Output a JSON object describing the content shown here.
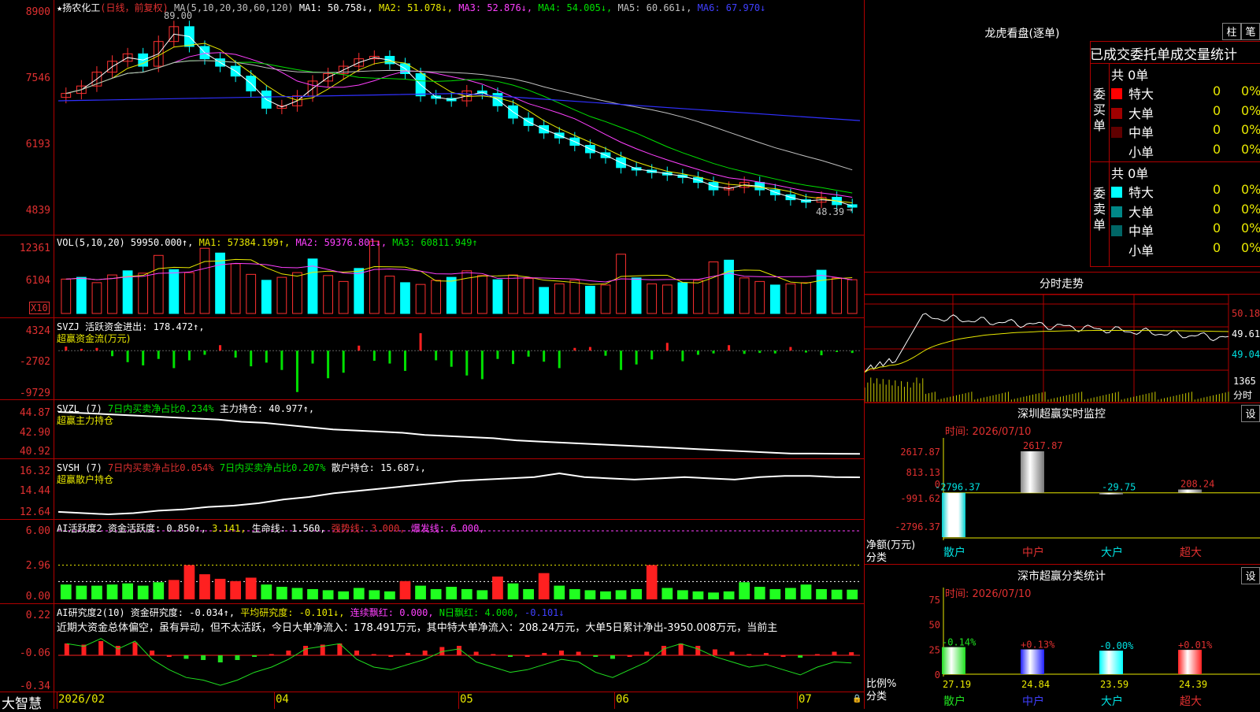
{
  "stock": {
    "name": "扬农化工",
    "period_label": "(日线，前复权)",
    "high_marker": "89.00",
    "low_marker": "48.39"
  },
  "main_panel": {
    "legend": [
      {
        "text": "MA(5,10,20,30,60,120)",
        "color": "#c0c0c0"
      },
      {
        "text": "MA1: 50.758↓,",
        "color": "#ffffff"
      },
      {
        "text": "MA2: 51.078↓,",
        "color": "#e8e800"
      },
      {
        "text": "MA3: 52.876↓,",
        "color": "#ff40ff"
      },
      {
        "text": "MA4: 54.005↓,",
        "color": "#00e000"
      },
      {
        "text": "MA5: 60.661↓,",
        "color": "#c0c0c0"
      },
      {
        "text": "MA6: 67.970↓",
        "color": "#4040ff"
      }
    ],
    "y_ticks": [
      "8900",
      "7546",
      "6193",
      "4839"
    ]
  },
  "vol_panel": {
    "legend": [
      {
        "text": "VOL(5,10,20) 59950.000↑,",
        "color": "#ffffff"
      },
      {
        "text": "MA1: 57384.199↑,",
        "color": "#e8e800"
      },
      {
        "text": "MA2: 59376.801↓,",
        "color": "#ff40ff"
      },
      {
        "text": "MA3: 60811.949↑",
        "color": "#00e000"
      }
    ],
    "y_ticks": [
      "12361",
      "6104"
    ],
    "unit": "X10"
  },
  "svzj_panel": {
    "legend": [
      {
        "text": "SVZJ  活跃资金进出: 178.472↑,",
        "color": "#ffffff"
      }
    ],
    "subtitle": "超赢资金流(万元)",
    "y_ticks": [
      "4324",
      "-2702",
      "-9729"
    ]
  },
  "svzl_panel": {
    "legend": [
      {
        "text": "SVZL (7)",
        "color": "#ffffff"
      },
      {
        "text": "7日内买卖净占比0.234%",
        "color": "#00e000"
      },
      {
        "text": "主力持仓: 40.977↑,",
        "color": "#ffffff"
      }
    ],
    "subtitle": "超赢主力持仓",
    "y_ticks": [
      "44.87",
      "42.90",
      "40.92"
    ]
  },
  "svsh_panel": {
    "legend": [
      {
        "text": "SVSH (7)",
        "color": "#ffffff"
      },
      {
        "text": "7日内买卖净占比0.054%",
        "color": "#e03030"
      },
      {
        "text": "7日内买卖净占比0.207%",
        "color": "#00e000"
      },
      {
        "text": "散户持仓: 15.687↓,",
        "color": "#ffffff"
      }
    ],
    "subtitle": "超赢散户持仓",
    "y_ticks": [
      "16.32",
      "14.44",
      "12.64"
    ]
  },
  "ai_active_panel": {
    "legend": [
      {
        "text": "AI活跃度2 资金活跃度: 0.850↑,",
        "color": "#ffffff"
      },
      {
        "text": "3.141,",
        "color": "#e8e800"
      },
      {
        "text": "生命线: 1.560,",
        "color": "#ffffff"
      },
      {
        "text": "强势线: 3.000,",
        "color": "#e03030"
      },
      {
        "text": "爆发线: 6.000,",
        "color": "#ff40ff"
      }
    ],
    "y_ticks": [
      "6.00",
      "2.96",
      "0.00"
    ]
  },
  "ai_research_panel": {
    "legend": [
      {
        "text": "AI研究度2(10) 资金研究度: -0.034↑,",
        "color": "#ffffff"
      },
      {
        "text": "平均研究度: -0.101↓,",
        "color": "#e8e800"
      },
      {
        "text": "连续飘红: 0.000,",
        "color": "#ff40ff"
      },
      {
        "text": "N日飘红: 4.000,",
        "color": "#00e000"
      },
      {
        "text": "-0.101↓",
        "color": "#4040ff"
      }
    ],
    "commentary": "近期大资金总体偏空，虽有异动，但不太活跃，今日大单净流入：178.491万元，其中特大单净流入：208.24万元，大单5日累计净出-3950.008万元，当前主",
    "y_ticks": [
      "0.22",
      "-0.06",
      "-0.34"
    ]
  },
  "x_axis": [
    "2026/02",
    "04",
    "05",
    "06",
    "07"
  ],
  "brand": "大智慧",
  "dragon_tiger": {
    "title": "龙虎看盘(逐单)",
    "btn_bar": "柱",
    "btn_stroke": "笔",
    "subtitle": "已成交委托单成交量统计",
    "buy_label": "委买单",
    "sell_label": "委卖单",
    "buy_total": "共 0单",
    "sell_total": "共 0单",
    "buy_rows": [
      {
        "label": "特大",
        "count": "0",
        "pct": "0%",
        "color": "#ff0000"
      },
      {
        "label": "大单",
        "count": "0",
        "pct": "0%",
        "color": "#a00000"
      },
      {
        "label": "中单",
        "count": "0",
        "pct": "0%",
        "color": "#600000"
      },
      {
        "label": "小单",
        "count": "0",
        "pct": "0%",
        "color": ""
      }
    ],
    "sell_rows": [
      {
        "label": "特大",
        "count": "0",
        "pct": "0%",
        "color": "#00ffff"
      },
      {
        "label": "大单",
        "count": "0",
        "pct": "0%",
        "color": "#008888"
      },
      {
        "label": "中单",
        "count": "0",
        "pct": "0%",
        "color": "#006666"
      },
      {
        "label": "小单",
        "count": "0",
        "pct": "0%",
        "color": ""
      }
    ]
  },
  "intraday": {
    "title": "分时走势",
    "y_ticks": [
      "50.18",
      "49.61",
      "49.04"
    ],
    "vol_tick": "1365",
    "vol_label": "分时"
  },
  "sz_monitor": {
    "title": "深圳超赢实时监控",
    "btn": "设",
    "time": "时间: 2026/07/10",
    "y_ticks": [
      "2617.87",
      "813.13",
      "0",
      "-991.62",
      "-2796.37"
    ],
    "y_label": "净额(万元)",
    "x_label": "分类",
    "categories": [
      "散户",
      "中户",
      "大户",
      "超大"
    ],
    "values": [
      "-2796.37",
      "2617.87",
      "-29.75",
      "208.24"
    ]
  },
  "sz_class": {
    "title": "深市超赢分类统计",
    "btn": "设",
    "time": "时间: 2026/07/10",
    "y_ticks": [
      "75",
      "50",
      "25",
      "0"
    ],
    "y_label": "比例%",
    "x_label": "分类",
    "categories": [
      "散户",
      "中户",
      "大户",
      "超大"
    ],
    "changes": [
      "-0.14%",
      "+0.13%",
      "-0.00%",
      "+0.01%"
    ],
    "values": [
      "27.19",
      "24.84",
      "23.59",
      "24.39"
    ]
  },
  "chart_data": [
    {
      "type": "candlestick",
      "title": "扬农化工(日线，前复权)",
      "ylim": [
        4839,
        8900
      ],
      "x": [
        "2026/02",
        "04",
        "05",
        "06",
        "07"
      ],
      "close": [
        7250,
        7400,
        7680,
        7900,
        8050,
        7800,
        8300,
        8600,
        8200,
        7950,
        7800,
        7600,
        7300,
        6950,
        7000,
        7200,
        7500,
        7650,
        7800,
        7950,
        8000,
        7850,
        7650,
        7200,
        7150,
        7100,
        7300,
        7250,
        7000,
        6750,
        6600,
        6450,
        6350,
        6200,
        6050,
        5950,
        5750,
        5700,
        5650,
        5600,
        5550,
        5450,
        5300,
        5350,
        5450,
        5300,
        5200,
        5100,
        5050,
        5150,
        5000,
        4950
      ]
    },
    {
      "type": "bar",
      "title": "VOL(5,10,20)",
      "ylim": [
        0,
        12361
      ],
      "values": [
        5800,
        6100,
        5200,
        6500,
        7200,
        6800,
        9800,
        7400,
        6900,
        11000,
        10200,
        8400,
        6600,
        5600,
        6100,
        6900,
        9200,
        6400,
        5400,
        7600,
        12200,
        6300,
        5200,
        4900,
        5600,
        6100,
        7200,
        6400,
        5700,
        6500,
        5900,
        4400,
        5000,
        5600,
        4600,
        4800,
        10000,
        6000,
        5000,
        4800,
        5200,
        5600,
        8700,
        9000,
        6000,
        5400,
        4800,
        5000,
        5200,
        7300,
        6000,
        5700
      ]
    },
    {
      "type": "bar",
      "title": "超赢资金流(万元)",
      "ylim": [
        -9729,
        4324
      ],
      "values": [
        900,
        400,
        600,
        -1200,
        -2500,
        -3200,
        -1800,
        -3800,
        -2100,
        -900,
        1200,
        -1500,
        -3400,
        -2600,
        -4200,
        -9000,
        -2800,
        -6000,
        -4800,
        1100,
        -2200,
        -2800,
        -4400,
        3800,
        -2100,
        -3500,
        -5400,
        -6200,
        -1800,
        -2900,
        -1300,
        -2400,
        -3800,
        600,
        800,
        -1100,
        -4200,
        -3000,
        -1900,
        1700,
        -2300,
        -900,
        -600,
        1200,
        -700,
        -500,
        -600,
        800,
        -400,
        -1000,
        -300,
        -500
      ]
    },
    {
      "type": "line",
      "title": "超赢主力持仓",
      "ylim": [
        40.92,
        44.87
      ],
      "values": [
        44.8,
        44.7,
        44.6,
        44.5,
        44.4,
        44.3,
        44.2,
        44.1,
        43.9,
        43.8,
        43.6,
        43.4,
        43.2,
        43.1,
        43.0,
        42.9,
        42.7,
        42.6,
        42.5,
        42.4,
        42.2,
        42.1,
        42.0,
        41.9,
        41.8,
        41.7,
        41.6,
        41.5,
        41.4,
        41.3,
        41.2,
        41.1,
        41.0,
        41.0,
        40.98,
        40.977
      ]
    },
    {
      "type": "line",
      "title": "超赢散户持仓",
      "ylim": [
        12.64,
        16.32
      ],
      "values": [
        12.9,
        12.8,
        12.7,
        12.8,
        13.0,
        13.1,
        13.3,
        13.4,
        13.6,
        13.9,
        14.1,
        14.4,
        14.6,
        14.8,
        15.0,
        15.2,
        15.4,
        15.5,
        15.6,
        15.7,
        16.0,
        15.7,
        15.6,
        15.5,
        15.6,
        15.7,
        15.6,
        15.5,
        15.7,
        15.8,
        15.8,
        15.7,
        15.687
      ]
    },
    {
      "type": "bar",
      "title": "AI活跃度2",
      "ylim": [
        0,
        6.0
      ],
      "values": [
        1.3,
        1.2,
        1.2,
        1.3,
        1.4,
        1.2,
        1.5,
        1.7,
        3.0,
        2.2,
        1.8,
        1.6,
        1.9,
        1.3,
        1.1,
        1.0,
        0.9,
        0.8,
        0.7,
        1.0,
        0.8,
        0.7,
        1.6,
        1.2,
        0.9,
        1.1,
        0.9,
        0.8,
        2.0,
        1.4,
        0.9,
        2.3,
        1.2,
        0.9,
        0.8,
        0.7,
        0.8,
        0.9,
        3.0,
        1.0,
        0.8,
        0.7,
        0.6,
        0.7,
        1.5,
        1.1,
        0.9,
        1.0,
        1.3,
        0.9,
        0.85,
        0.85
      ]
    },
    {
      "type": "bar",
      "title": "AI研究度2(10)",
      "ylim": [
        -0.34,
        0.22
      ],
      "values": [
        0.04,
        0.03,
        0.06,
        0.02,
        0.05,
        -0.02,
        -0.06,
        -0.09,
        -0.1,
        -0.12,
        -0.1,
        -0.07,
        -0.05,
        -0.02,
        0.02,
        0.03,
        0.04,
        -0.02,
        -0.05,
        -0.06,
        -0.04,
        -0.02,
        0.01,
        0.02,
        -0.03,
        -0.05,
        -0.07,
        -0.06,
        -0.04,
        -0.02,
        -0.03,
        -0.07,
        -0.09,
        -0.06,
        -0.03,
        0.02,
        0.04,
        0.02,
        -0.01,
        -0.03,
        -0.05,
        -0.04,
        -0.06,
        -0.08,
        -0.05,
        -0.03,
        -0.034
      ]
    }
  ]
}
